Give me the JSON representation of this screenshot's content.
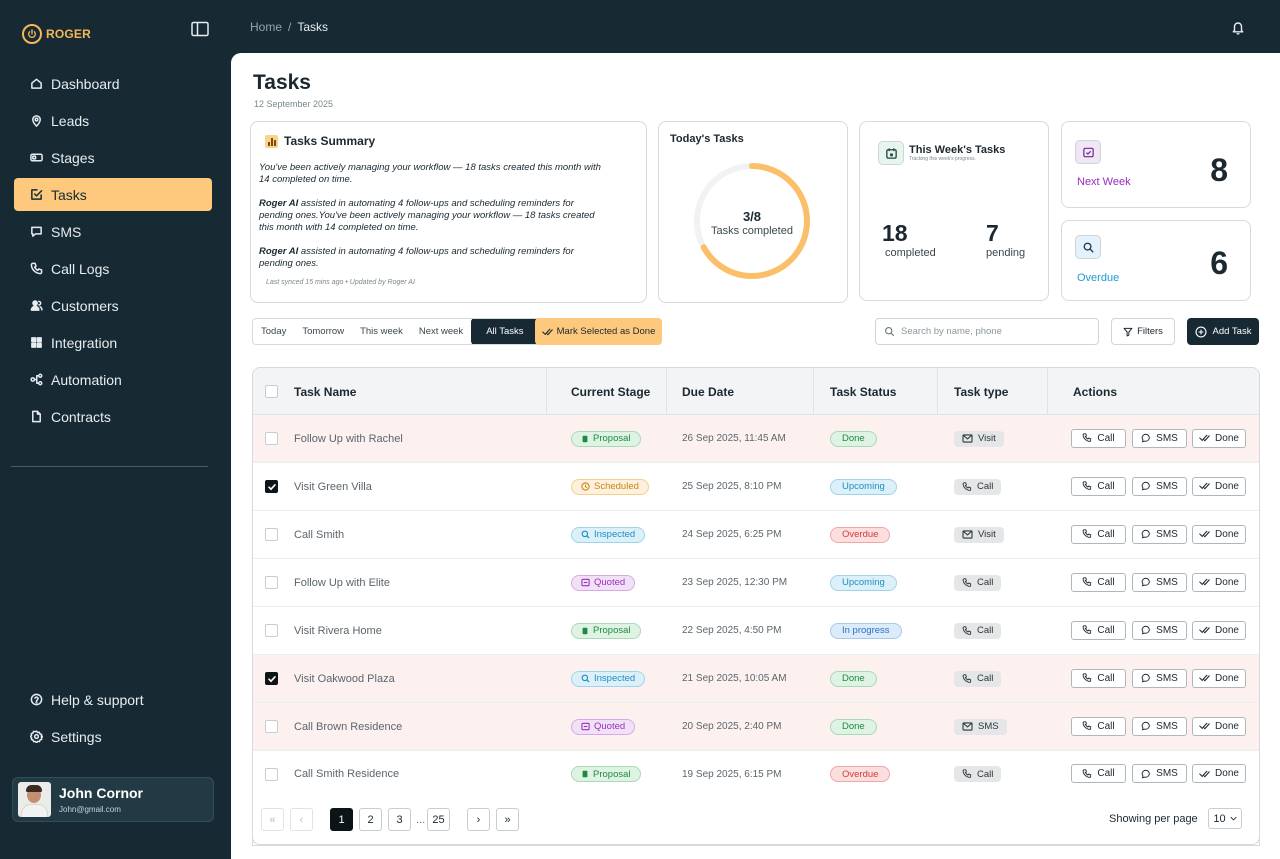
{
  "app": {
    "name": "ROGER"
  },
  "sidebar": {
    "items": [
      {
        "label": "Dashboard",
        "icon": "home-icon"
      },
      {
        "label": "Leads",
        "icon": "pin-icon"
      },
      {
        "label": "Stages",
        "icon": "stages-icon"
      },
      {
        "label": "Tasks",
        "icon": "tasks-icon",
        "active": true
      },
      {
        "label": "SMS",
        "icon": "sms-icon"
      },
      {
        "label": "Call Logs",
        "icon": "phone-icon"
      },
      {
        "label": "Customers",
        "icon": "customers-icon"
      },
      {
        "label": "Integration",
        "icon": "grid-icon"
      },
      {
        "label": "Automation",
        "icon": "automation-icon"
      },
      {
        "label": "Contracts",
        "icon": "contract-icon"
      }
    ],
    "bottom": [
      {
        "label": "Help & support",
        "icon": "help-icon"
      },
      {
        "label": "Settings",
        "icon": "gear-icon"
      }
    ],
    "user": {
      "name": "John Cornor",
      "email": "John@gmail.com"
    }
  },
  "breadcrumb": {
    "home": "Home",
    "separator": "/",
    "current": "Tasks"
  },
  "page": {
    "title": "Tasks",
    "date": "12 September 2025"
  },
  "summary": {
    "title": "Tasks Summary",
    "p1": "You've been actively managing your workflow — 18 tasks created this month with 14 completed on time.",
    "p2_bold": "Roger AI",
    "p2": " assisted in automating 4 follow-ups and scheduling reminders for pending ones.You've been actively managing your workflow — 18 tasks created this month with 14 completed on time.",
    "p3_bold": "Roger AI",
    "p3": " assisted in automating 4 follow-ups and scheduling reminders for pending ones.",
    "sync": "Last synced 15 mins ago • Updated by Roger AI"
  },
  "today": {
    "title": "Today's Tasks",
    "value": "3/8",
    "label": "Tasks completed",
    "completed": 3,
    "total": 8
  },
  "week": {
    "title": "This Week's Tasks",
    "subtitle": "Tracking this week's progress.",
    "completed": "18",
    "completed_label": "completed",
    "pending": "7",
    "pending_label": "pending"
  },
  "next_week": {
    "label": "Next Week",
    "value": "8"
  },
  "overdue": {
    "label": "Overdue",
    "value": "6"
  },
  "filters": [
    "Today",
    "Tomorrow",
    "This week",
    "Next week",
    "All Tasks"
  ],
  "filters_active": 4,
  "toolbar": {
    "mark_done": "Mark Selected as Done",
    "search_placeholder": "Search by name, phone",
    "filters": "Filters",
    "add_task": "Add Task"
  },
  "table": {
    "columns": [
      "Task Name",
      "Current Stage",
      "Due Date",
      "Task Status",
      "Task type",
      "Actions"
    ],
    "actions": {
      "call": "Call",
      "sms": "SMS",
      "done": "Done"
    },
    "rows": [
      {
        "name": "Follow Up with Rachel",
        "stage": "Proposal",
        "due": "26 Sep 2025, 11:45 AM",
        "status": "Done",
        "type": "Visit",
        "checked": false,
        "highlight": true
      },
      {
        "name": "Visit Green Villa",
        "stage": "Scheduled",
        "due": "25 Sep 2025, 8:10 PM",
        "status": "Upcoming",
        "type": "Call",
        "checked": true,
        "highlight": false
      },
      {
        "name": "Call Smith",
        "stage": "Inspected",
        "due": "24 Sep 2025, 6:25 PM",
        "status": "Overdue",
        "type": "Visit",
        "checked": false,
        "highlight": false
      },
      {
        "name": "Follow Up with Elite",
        "stage": "Quoted",
        "due": "23 Sep 2025, 12:30 PM",
        "status": "Upcoming",
        "type": "Call",
        "checked": false,
        "highlight": false
      },
      {
        "name": "Visit Rivera Home",
        "stage": "Proposal",
        "due": "22 Sep 2025, 4:50 PM",
        "status": "In progress",
        "type": "Call",
        "checked": false,
        "highlight": false
      },
      {
        "name": "Visit Oakwood Plaza",
        "stage": "Inspected",
        "due": "21 Sep 2025, 10:05 AM",
        "status": "Done",
        "type": "Call",
        "checked": true,
        "highlight": true
      },
      {
        "name": "Call Brown Residence",
        "stage": "Quoted",
        "due": "20 Sep 2025, 2:40 PM",
        "status": "Done",
        "type": "SMS",
        "checked": false,
        "highlight": true
      },
      {
        "name": "Call Smith Residence",
        "stage": "Proposal",
        "due": "19 Sep 2025, 6:15 PM",
        "status": "Overdue",
        "type": "Call",
        "checked": false,
        "highlight": false
      }
    ]
  },
  "pagination": {
    "pages": [
      "1",
      "2",
      "3"
    ],
    "dots": "...",
    "last": "25",
    "current": "1",
    "per_page_label": "Showing per page",
    "per_page": "10"
  },
  "colors": {
    "sidebar_bg": "#172a33",
    "accent": "#fec97d",
    "logo": "#f5b75a"
  }
}
